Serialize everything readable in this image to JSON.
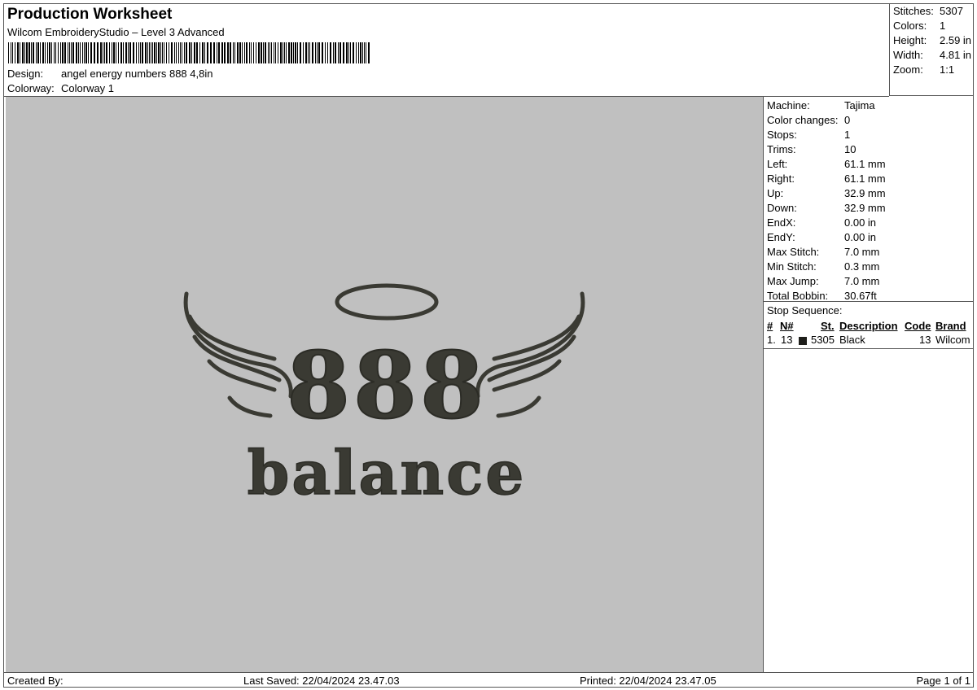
{
  "header": {
    "title": "Production Worksheet",
    "subtitle": "Wilcom EmbroideryStudio – Level 3 Advanced",
    "design_label": "Design:",
    "design_value": "angel energy numbers 888 4,8in",
    "colorway_label": "Colorway:",
    "colorway_value": "Colorway 1"
  },
  "summary": [
    {
      "label": "Stitches:",
      "value": "5307"
    },
    {
      "label": "Colors:",
      "value": "1"
    },
    {
      "label": "Height:",
      "value": "2.59 in"
    },
    {
      "label": "Width:",
      "value": "4.81 in"
    },
    {
      "label": "Zoom:",
      "value": "1:1"
    }
  ],
  "details": [
    {
      "label": "Machine:",
      "value": "Tajima"
    },
    {
      "label": "Color changes:",
      "value": "0"
    },
    {
      "label": "Stops:",
      "value": "1"
    },
    {
      "label": "Trims:",
      "value": "10"
    },
    {
      "label": "Left:",
      "value": "61.1 mm"
    },
    {
      "label": "Right:",
      "value": "61.1 mm"
    },
    {
      "label": "Up:",
      "value": "32.9 mm"
    },
    {
      "label": "Down:",
      "value": "32.9 mm"
    },
    {
      "label": "EndX:",
      "value": "0.00 in"
    },
    {
      "label": "EndY:",
      "value": "0.00 in"
    },
    {
      "label": "Max Stitch:",
      "value": "7.0 mm"
    },
    {
      "label": "Min Stitch:",
      "value": "0.3 mm"
    },
    {
      "label": "Max Jump:",
      "value": "7.0 mm"
    },
    {
      "label": "Total Bobbin:",
      "value": "30.67ft"
    }
  ],
  "stop_sequence": {
    "label": "Stop Sequence:",
    "columns": [
      "#",
      "N#",
      "St.",
      "Description",
      "Code",
      "Brand"
    ],
    "rows": [
      {
        "index": "1.",
        "needle": "13",
        "stitches": "5305",
        "description": "Black",
        "code": "13",
        "brand": "Wilcom",
        "color": "#1e1e1a"
      }
    ]
  },
  "design_preview": {
    "digits": "888",
    "word": "balance",
    "thread_color": "#3a3a33",
    "background": "#c0c0c0"
  },
  "footer": {
    "created_by": "Created By:",
    "last_saved": "Last Saved: 22/04/2024 23.47.03",
    "printed": "Printed: 22/04/2024 23.47.05",
    "page": "Page 1 of 1"
  }
}
